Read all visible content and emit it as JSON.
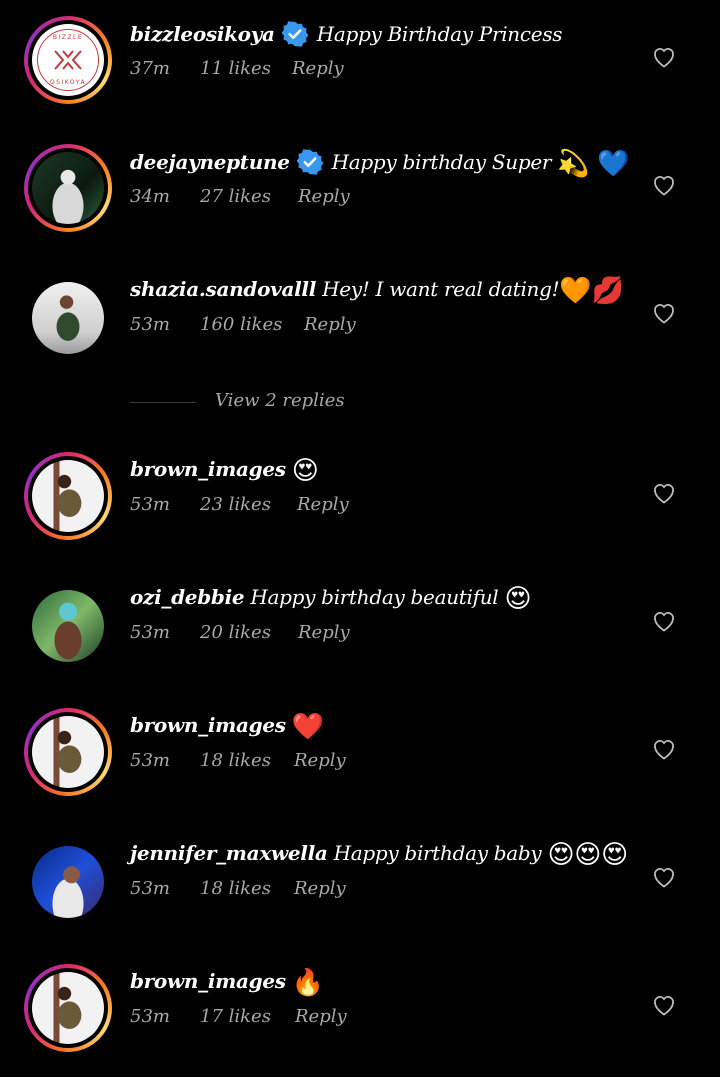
{
  "comments": [
    {
      "username": "bizzleosikoya",
      "verified": true,
      "text": "Happy Birthday Princess",
      "emoji": "",
      "time": "37m",
      "likes": "11 likes",
      "reply": "Reply",
      "avatar": "logo"
    },
    {
      "username": "deejayneptune",
      "verified": true,
      "text": "Happy birthday Super",
      "emoji": "💫 💙",
      "time": "34m",
      "likes": "27 likes",
      "reply": "Reply",
      "avatar": "dj"
    },
    {
      "username": "shazia.sandovalll",
      "verified": false,
      "text": "Hey!  I want real dating!",
      "emoji": "🧡💋",
      "time": "53m",
      "likes": "160 likes",
      "reply": "Reply",
      "avatar": "photo"
    },
    {
      "username": "brown_images",
      "verified": false,
      "text": "",
      "emoji": "😍",
      "time": "53m",
      "likes": "23 likes",
      "reply": "Reply",
      "avatar": "brown"
    },
    {
      "username": "ozi_debbie",
      "verified": false,
      "text": "Happy birthday beautiful",
      "emoji": "😍",
      "time": "53m",
      "likes": "20 likes",
      "reply": "Reply",
      "avatar": "photo2"
    },
    {
      "username": "brown_images",
      "verified": false,
      "text": "",
      "emoji": "❤️",
      "time": "53m",
      "likes": "18 likes",
      "reply": "Reply",
      "avatar": "brown"
    },
    {
      "username": "jennifer_maxwella",
      "verified": false,
      "text": "Happy birthday baby",
      "emoji": "😍😍😍",
      "time": "53m",
      "likes": "18 likes",
      "reply": "Reply",
      "avatar": "photo3"
    },
    {
      "username": "brown_images",
      "verified": false,
      "text": "",
      "emoji": "🔥",
      "time": "53m",
      "likes": "17 likes",
      "reply": "Reply",
      "avatar": "brown"
    }
  ],
  "view_replies": "View 2 replies",
  "logo_ring_top": "BIZZLE",
  "logo_ring_bottom": "OSIKOYA",
  "colors": {
    "background": "#000000",
    "text": "#ffffff",
    "secondary": "#a8a8a8",
    "verified": "#3897f0"
  }
}
